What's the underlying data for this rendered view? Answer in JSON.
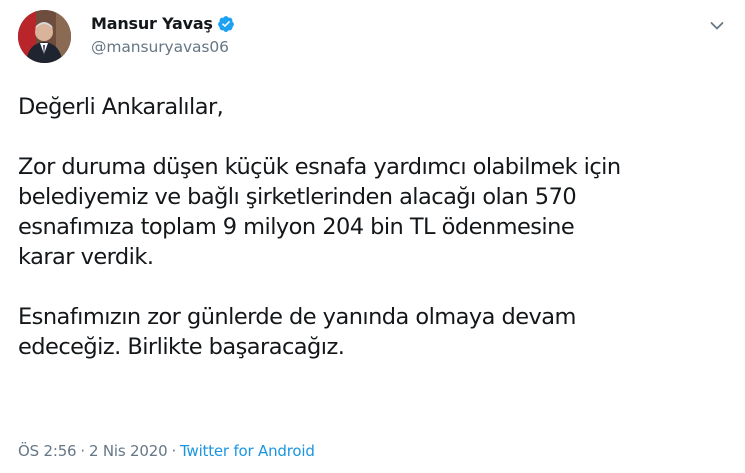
{
  "author": {
    "display_name": "Mansur Yavaş",
    "handle": "@mansuryavas06",
    "verified_icon": "verified-badge-icon",
    "avatar": "profile-photo"
  },
  "menu": {
    "icon": "chevron-down-icon"
  },
  "tweet": {
    "paragraphs": [
      "Değerli Ankaralılar,",
      "Zor duruma düşen küçük esnafa yardımcı olabilmek için\nbelediyemiz ve bağlı şirketlerinden alacağı olan 570\nesnafımıza toplam 9 milyon 204 bin TL ödenmesine\nkarar verdik.",
      "Esnafımızın zor günlerde de yanında olmaya devam\nedeceğiz. Birlikte başaracağız."
    ]
  },
  "meta": {
    "time": "ÖS 2:56",
    "separator": "·",
    "date": "2 Nis 2020",
    "source": "Twitter for Android"
  },
  "colors": {
    "text": "#14171a",
    "secondary": "#657786",
    "link": "#1b95e0",
    "verified": "#1da1f2"
  }
}
